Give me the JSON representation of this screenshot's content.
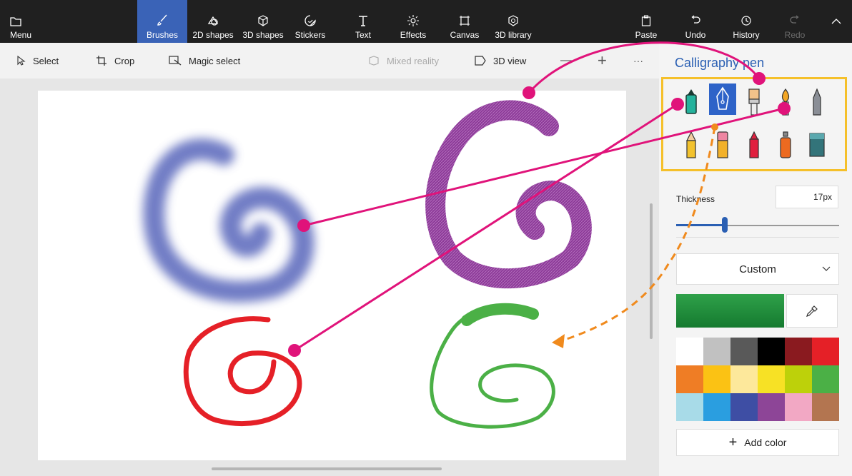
{
  "topbar": {
    "menu": "Menu",
    "tabs": [
      {
        "label": "Brushes",
        "icon": "brush-icon",
        "active": true
      },
      {
        "label": "2D shapes",
        "icon": "2d-shapes-icon"
      },
      {
        "label": "3D shapes",
        "icon": "3d-shapes-icon"
      },
      {
        "label": "Stickers",
        "icon": "sticker-icon"
      },
      {
        "label": "Text",
        "icon": "text-icon"
      },
      {
        "label": "Effects",
        "icon": "effects-icon"
      },
      {
        "label": "Canvas",
        "icon": "canvas-icon"
      },
      {
        "label": "3D library",
        "icon": "3d-library-icon"
      }
    ],
    "paste": "Paste",
    "undo": "Undo",
    "history": "History",
    "redo": "Redo"
  },
  "toolbar": {
    "select": "Select",
    "crop": "Crop",
    "magic_select": "Magic select",
    "mixed_reality": "Mixed reality",
    "view_3d": "3D view",
    "zoom_out": "—",
    "zoom_in": "+",
    "more": "···"
  },
  "panel": {
    "title": "Calligraphy pen",
    "thickness_label": "Thickness",
    "thickness_value": "17px",
    "thickness_level": 0.3,
    "texture": "Custom",
    "current_color": "#2a9a45",
    "add_color": "Add color",
    "palette": [
      "#ffffff",
      "#c1c1c1",
      "#595959",
      "#000000",
      "#8a1a1f",
      "#e52027",
      "#ef7d25",
      "#fbc214",
      "#fde89b",
      "#f7e125",
      "#bdd10a",
      "#4bb046",
      "#a8dbe8",
      "#2a9ee0",
      "#3e4ea4",
      "#8d4597",
      "#f2a8c4",
      "#b37550"
    ],
    "brushes": [
      {
        "icon": "marker-icon"
      },
      {
        "icon": "calligraphy-pen-icon",
        "selected": true
      },
      {
        "icon": "oil-brush-icon"
      },
      {
        "icon": "watercolor-icon"
      },
      {
        "icon": "pencil-icon"
      },
      {
        "icon": "graphite-pencil-icon"
      },
      {
        "icon": "eraser-icon"
      },
      {
        "icon": "crayon-icon"
      },
      {
        "icon": "spray-can-icon"
      },
      {
        "icon": "fill-bucket-icon"
      }
    ]
  },
  "colors": {
    "accent": "#2a5fb3",
    "callout": "#e0137a",
    "dash": "#f08a1d",
    "highlight": "#f5c02a"
  }
}
